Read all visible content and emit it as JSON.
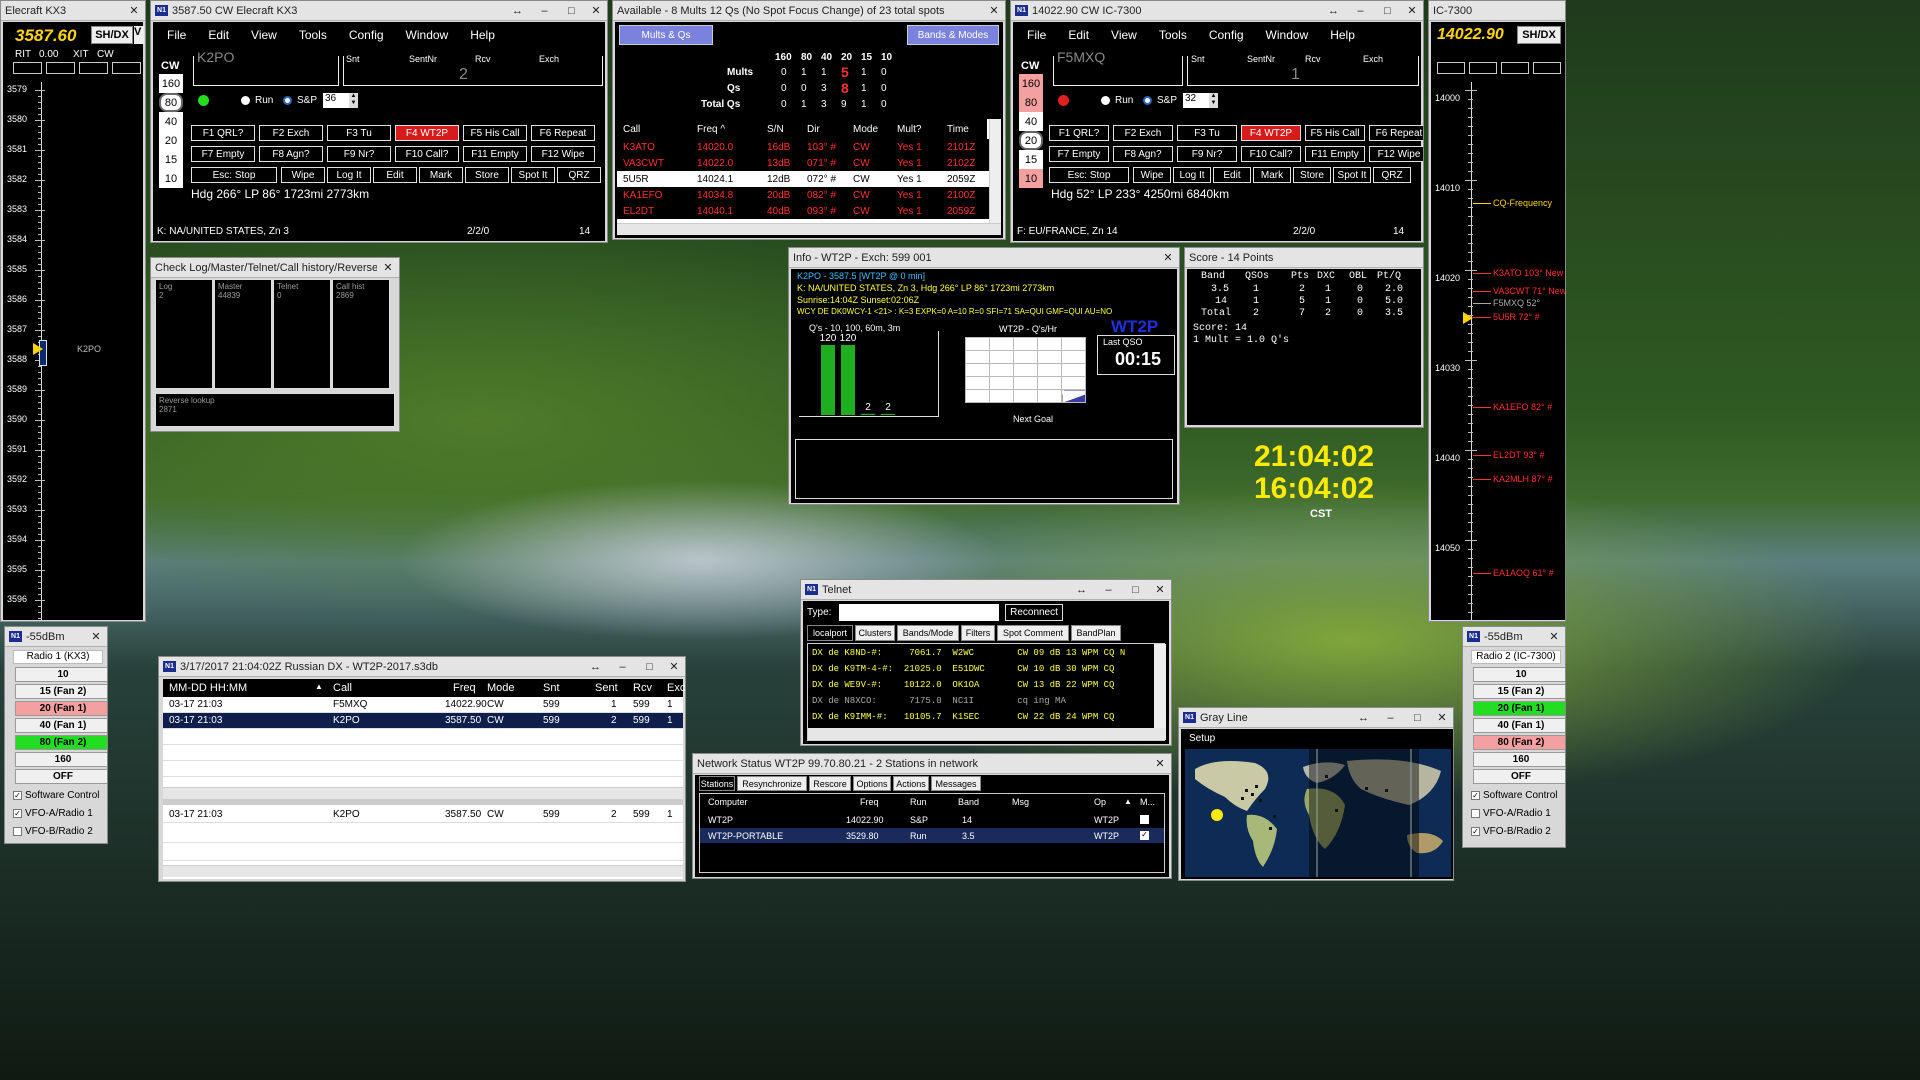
{
  "kx3_bandmap": {
    "title": "Elecraft KX3",
    "freq": "3587.60",
    "shdx": "SH/DX",
    "v": "V",
    "rit_label": "RIT",
    "rit": "0.00",
    "xit_label": "XIT",
    "mode": "CW",
    "ticks": [
      "3579",
      "3580",
      "3581",
      "3582",
      "3583",
      "3584",
      "3585",
      "3586",
      "3587",
      "3588",
      "3589",
      "3590",
      "3591",
      "3592",
      "3593",
      "3594",
      "3595",
      "3596"
    ],
    "marker_call": "K2PO"
  },
  "entry1": {
    "title": "3587.50 CW Elecraft KX3",
    "menu": [
      "File",
      "Edit",
      "View",
      "Tools",
      "Config",
      "Window",
      "Help"
    ],
    "mode": "CW",
    "bands": [
      "160",
      "80",
      "40",
      "20",
      "15",
      "10"
    ],
    "selected_band": "80",
    "call": "K2PO",
    "col_snt": "Snt",
    "col_sentnr": "SentNr",
    "col_rcv": "Rcv",
    "col_exch": "Exch",
    "sentnr": "2",
    "run": "Run",
    "sp": "S&P",
    "speed": "36",
    "fkeys": [
      "F1 QRL?",
      "F2 Exch",
      "F3 Tu",
      "F4 WT2P",
      "F5 His Call",
      "F6 Repeat",
      "F7 Empty",
      "F8 Agn?",
      "F9 Nr?",
      "F10 Call?",
      "F11 Empty",
      "F12 Wipe",
      "Esc: Stop",
      "Wipe",
      "Log It",
      "Edit",
      "Mark",
      "Store",
      "Spot It",
      "QRZ"
    ],
    "hdg": "Hdg  266°  LP 86°  1723mi  2773km",
    "status": "K: NA/UNITED STATES, Zn 3",
    "count": "2/2/0",
    "num": "14"
  },
  "available": {
    "title": "Available - 8 Mults 12 Qs  (No Spot Focus Change) of 23 total spots",
    "btn1": "Mults & Qs",
    "btn2": "Bands & Modes",
    "bands": [
      "160",
      "80",
      "40",
      "20",
      "15",
      "10"
    ],
    "rows": [
      {
        "label": "Mults",
        "vals": [
          "0",
          "1",
          "1",
          "5",
          "1",
          "0"
        ]
      },
      {
        "label": "Qs",
        "vals": [
          "0",
          "0",
          "3",
          "8",
          "1",
          "0"
        ]
      },
      {
        "label": "Total Qs",
        "vals": [
          "0",
          "1",
          "3",
          "9",
          "1",
          "0"
        ]
      }
    ],
    "headers": [
      "Call",
      "Freq ^",
      "S/N",
      "Dir",
      "Mode",
      "Mult?",
      "Time"
    ],
    "spots": [
      [
        "K3ATO",
        "14020.0",
        "16dB",
        "103° #",
        "CW",
        "Yes 1",
        "2101Z"
      ],
      [
        "VA3CWT",
        "14022.0",
        "13dB",
        "071° #",
        "CW",
        "Yes 1",
        "2102Z"
      ],
      [
        "5U5R",
        "14024.1",
        "12dB",
        "072° #",
        "CW",
        "Yes 1",
        "2059Z"
      ],
      [
        "KA1EFO",
        "14034.8",
        "20dB",
        "082° #",
        "CW",
        "Yes 1",
        "2100Z"
      ],
      [
        "EL2DT",
        "14040.1",
        "40dB",
        "093° #",
        "CW",
        "Yes 1",
        "2059Z"
      ]
    ]
  },
  "entry2": {
    "title": "14022.90 CW IC-7300",
    "menu": [
      "File",
      "Edit",
      "View",
      "Tools",
      "Config",
      "Window",
      "Help"
    ],
    "mode": "CW",
    "bands": [
      "160",
      "80",
      "40",
      "20",
      "15",
      "10"
    ],
    "selected_band": "20",
    "call": "F5MXQ",
    "col_snt": "Snt",
    "col_sentnr": "SentNr",
    "col_rcv": "Rcv",
    "col_exch": "Exch",
    "sentnr": "1",
    "run": "Run",
    "sp": "S&P",
    "speed": "32",
    "fkeys": [
      "F1 QRL?",
      "F2 Exch",
      "F3 Tu",
      "F4 WT2P",
      "F5 His Call",
      "F6 Repeat",
      "F7 Empty",
      "F8 Agn?",
      "F9 Nr?",
      "F10 Call?",
      "F11 Empty",
      "F12 Wipe",
      "Esc: Stop",
      "Wipe",
      "Log It",
      "Edit",
      "Mark",
      "Store",
      "Spot It",
      "QRZ"
    ],
    "hdg": "Hdg  52°  LP 233°  4250mi  6840km",
    "status": "F: EU/FRANCE, Zn 14",
    "count": "2/2/0",
    "num": "14"
  },
  "ic7300_bandmap": {
    "title": "IC-7300",
    "freq": "14022.90",
    "shdx": "SH/DX",
    "ticks": [
      "14000",
      "14010",
      "14020",
      "14030",
      "14040",
      "14050"
    ],
    "spots": [
      "CQ-Frequency",
      "K3ATO 103° New",
      "VA3CWT 71° New",
      "F5MXQ 52°",
      "5U5R 72° #",
      "KA1EFO 82° #",
      "EL2DT 93° #",
      "KA2MLH 87° #",
      "EA1AOQ 61° #"
    ]
  },
  "checklog": {
    "title": "Check Log/Master/Telnet/Call history/Reverse look...",
    "cols": [
      {
        "h": "Log",
        "v": "2"
      },
      {
        "h": "Master",
        "v": "44839"
      },
      {
        "h": "Telnet",
        "v": "0"
      },
      {
        "h": "Call hist",
        "v": "2869"
      }
    ],
    "rev_h": "Reverse lookup",
    "rev_v": "2871"
  },
  "info": {
    "title": "Info - WT2P - Exch: 599 001",
    "line1": "K2PO - 3587.5 [WT2P @ 0 min]",
    "line2": "K: NA/UNITED STATES, Zn 3, Hdg  266°  LP 86°  1723mi  2773km",
    "line3": "Sunrise:14:04Z Sunset:02:06Z",
    "line4": "WCY DE DK0WCY-1 <21> : K=3 EXPK=0 A=10 R=0 SFI=71 SA=QUI GMF=QUI AU=NO",
    "qs_title": "Q's - 10, 100, 60m, 3m",
    "bars": [
      {
        "label": "120",
        "value": 120
      },
      {
        "label": "120",
        "value": 120
      },
      {
        "label": "2",
        "value": 2
      },
      {
        "label": "2",
        "value": 2
      }
    ],
    "rate_title": "WT2P - Q's/Hr",
    "call_big": "WT2P",
    "last_qso_label": "Last QSO",
    "last_qso": "00:15",
    "next_goal": "Next Goal"
  },
  "score": {
    "title": "Score - 14 Points",
    "headers": [
      "Band",
      "QSOs",
      "Pts",
      "DXC",
      "OBL",
      "Pt/Q"
    ],
    "rows": [
      [
        "3.5",
        "1",
        "2",
        "1",
        "0",
        "2.0"
      ],
      [
        "14",
        "1",
        "5",
        "1",
        "0",
        "5.0"
      ],
      [
        "Total",
        "2",
        "7",
        "2",
        "0",
        "3.5"
      ]
    ],
    "score_line": "Score: 14",
    "mult_line": "1 Mult = 1.0 Q's"
  },
  "clock": {
    "utc": "21:04:02",
    "local": "16:04:02",
    "tz": "CST"
  },
  "radio1": {
    "title": "-55dBm",
    "name": "Radio 1 (KX3)",
    "bands": [
      "10",
      "15 (Fan 2)",
      "20 (Fan 1)",
      "40 (Fan 1)",
      "80 (Fan 2)",
      "160",
      "OFF"
    ],
    "colors": [
      "#f0f0f0",
      "#f0f0f0",
      "#f5a0a0",
      "#f0f0f0",
      "#22dd22",
      "#f0f0f0",
      "#f0f0f0"
    ],
    "checks": [
      "Software Control",
      "VFO-A/Radio 1",
      "VFO-B/Radio 2"
    ],
    "checked": [
      true,
      true,
      false
    ]
  },
  "radio2": {
    "title": "-55dBm",
    "name": "Radio 2 (IC-7300)",
    "bands": [
      "10",
      "15 (Fan 2)",
      "20 (Fan 1)",
      "40 (Fan 1)",
      "80 (Fan 2)",
      "160",
      "OFF"
    ],
    "colors": [
      "#f0f0f0",
      "#f0f0f0",
      "#22dd22",
      "#f0f0f0",
      "#f5a0a0",
      "#f0f0f0",
      "#f0f0f0"
    ],
    "checks": [
      "Software Control",
      "VFO-A/Radio 1",
      "VFO-B/Radio 2"
    ],
    "checked": [
      true,
      false,
      true
    ]
  },
  "log": {
    "title": "3/17/2017 21:04:02Z  Russian DX - WT2P-2017.s3db",
    "headers": [
      "MM-DD HH:MM",
      "Call",
      "Freq",
      "Mode",
      "Snt",
      "Sent",
      "Rcv",
      "Exc"
    ],
    "rows": [
      [
        "03-17 21:03",
        "F5MXQ",
        "14022.90",
        "CW",
        "599",
        "1",
        "599",
        "1"
      ],
      [
        "03-17 21:03",
        "K2PO",
        "3587.50",
        "CW",
        "599",
        "2",
        "599",
        "1"
      ]
    ],
    "bottom": [
      "03-17 21:03",
      "K2PO",
      "3587.50",
      "CW",
      "599",
      "2",
      "599",
      "1"
    ]
  },
  "telnet": {
    "title": "Telnet",
    "type_label": "Type:",
    "reconnect": "Reconnect",
    "tabs": [
      "localport",
      "Clusters",
      "Bands/Mode",
      "Filters",
      "Spot Comment",
      "BandPlan"
    ],
    "lines": [
      "DX de K8ND-#:     7061.7  W2WC        CW 09 dB 13 WPM CQ N",
      "DX de K9TM-4-#:  21025.0  E51DWC      CW 10 dB 30 WPM CQ",
      "DX de WE9V-#:    10122.0  OK1OA       CW 13 dB 22 WPM CQ",
      "DX de N8XCO:      7175.0  NC1I        cq ing MA",
      "DX de K9IMM-#:   10105.7  K1SEC       CW 22 dB 24 WPM CQ"
    ]
  },
  "network": {
    "title": "Network Status WT2P 99.70.80.21 - 2 Stations in network",
    "tabs": [
      "Stations",
      "Resynchronize",
      "Rescore",
      "Options",
      "Actions",
      "Messages"
    ],
    "headers": [
      "Computer",
      "Freq",
      "Run",
      "Band",
      "Msg",
      "Op",
      "M..."
    ],
    "rows": [
      [
        "WT2P",
        "14022.90",
        "S&P",
        "14",
        "",
        "WT2P"
      ],
      [
        "WT2P-PORTABLE",
        "3529.80",
        "Run",
        "3.5",
        "",
        "WT2P"
      ]
    ]
  },
  "grayline": {
    "title": "Gray Line",
    "setup": "Setup"
  }
}
